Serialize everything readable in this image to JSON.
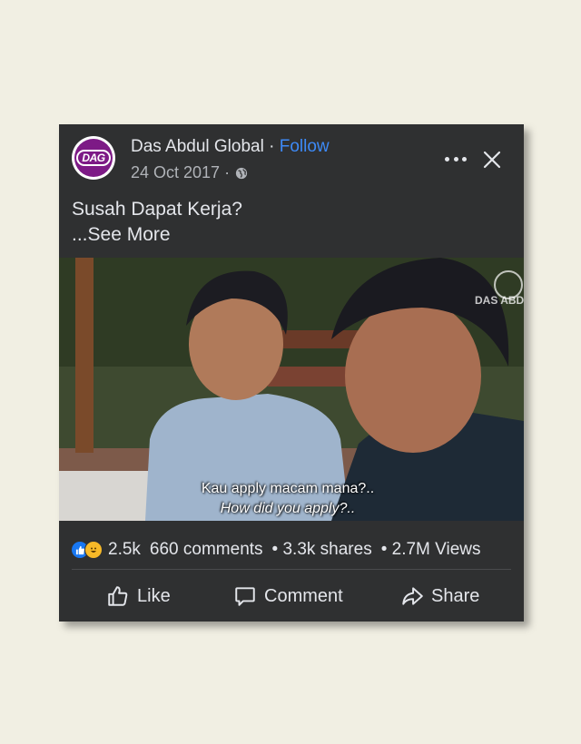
{
  "post": {
    "page_name": "Das Abdul Global",
    "separator": "·",
    "follow_label": "Follow",
    "date": "24 Oct 2017 ·",
    "avatar_text": "DAG",
    "caption": "Susah Dapat Kerja?",
    "see_more": "...See More"
  },
  "video": {
    "subtitle_line1": "Kau apply macam mana?..",
    "subtitle_line2": "How did you apply?..",
    "watermark": "DAS ABD"
  },
  "stats": {
    "reaction_icons": [
      "like-icon",
      "haha-icon"
    ],
    "reactions_count": "2.5k",
    "comments": "660 comments",
    "shares": "• 3.3k shares",
    "views": "• 2.7M Views"
  },
  "actions": {
    "like_label": "Like",
    "comment_label": "Comment",
    "share_label": "Share"
  },
  "colors": {
    "card_bg": "#2f3031",
    "follow": "#3d8af7",
    "page_bg": "#f1efe3",
    "avatar": "#7d1a86"
  }
}
